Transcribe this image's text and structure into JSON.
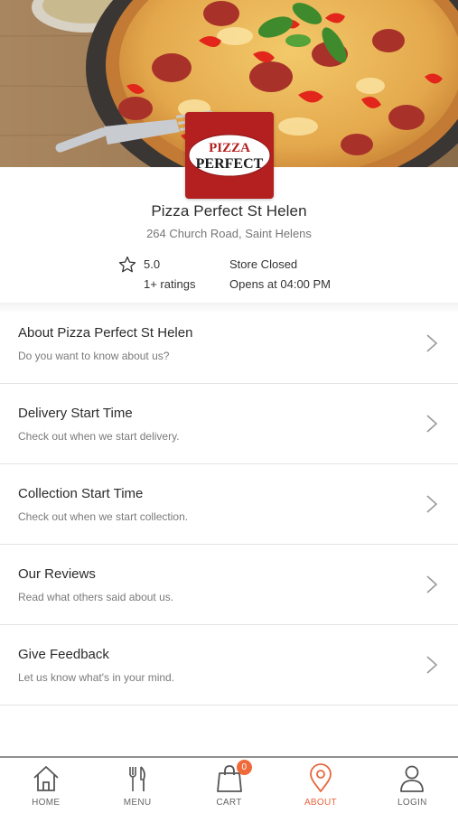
{
  "store": {
    "logo_text_top": "PIZZA",
    "logo_text_bottom": "PERFECT",
    "name": "Pizza Perfect St Helen",
    "address": "264 Church Road, Saint Helens",
    "rating": "5.0",
    "ratings_count": "1+ ratings",
    "status": "Store Closed",
    "opens_at": "Opens at 04:00 PM"
  },
  "info_items": [
    {
      "title": "About Pizza Perfect St Helen",
      "subtitle": "Do you want to know about us?"
    },
    {
      "title": "Delivery Start Time",
      "subtitle": "Check out when we start delivery."
    },
    {
      "title": "Collection Start Time",
      "subtitle": "Check out when we start collection."
    },
    {
      "title": "Our Reviews",
      "subtitle": "Read what others said about us."
    },
    {
      "title": "Give Feedback",
      "subtitle": "Let us know what's in your mind."
    }
  ],
  "nav": {
    "items": [
      {
        "label": "HOME",
        "icon": "home-icon"
      },
      {
        "label": "MENU",
        "icon": "fork-knife-icon"
      },
      {
        "label": "CART",
        "icon": "shopping-bag-icon",
        "badge": "0"
      },
      {
        "label": "ABOUT",
        "icon": "location-pin-icon",
        "active": true
      },
      {
        "label": "LOGIN",
        "icon": "user-icon"
      }
    ]
  },
  "colors": {
    "accent": "#e8663c",
    "logo_red": "#b3201f",
    "badge": "#ef6a3b"
  }
}
